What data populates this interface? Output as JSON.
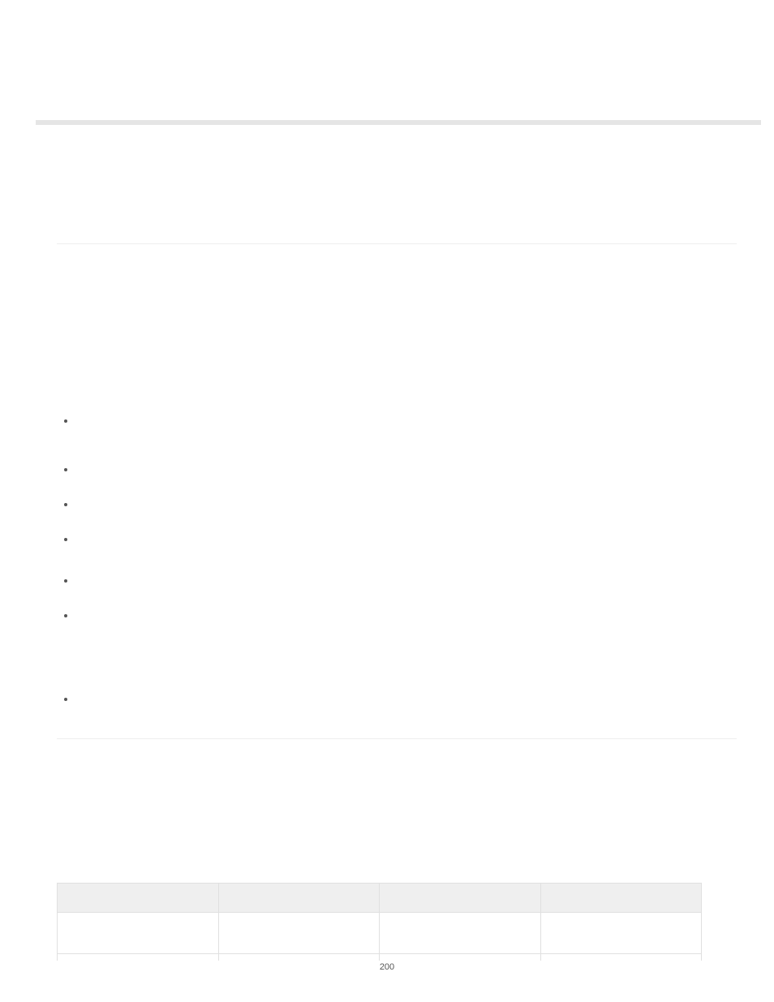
{
  "page": {
    "number": "200"
  },
  "table": {
    "columns": 4,
    "headers": [
      "",
      "",
      "",
      ""
    ],
    "rows": [
      [
        "",
        "",
        "",
        ""
      ]
    ]
  }
}
